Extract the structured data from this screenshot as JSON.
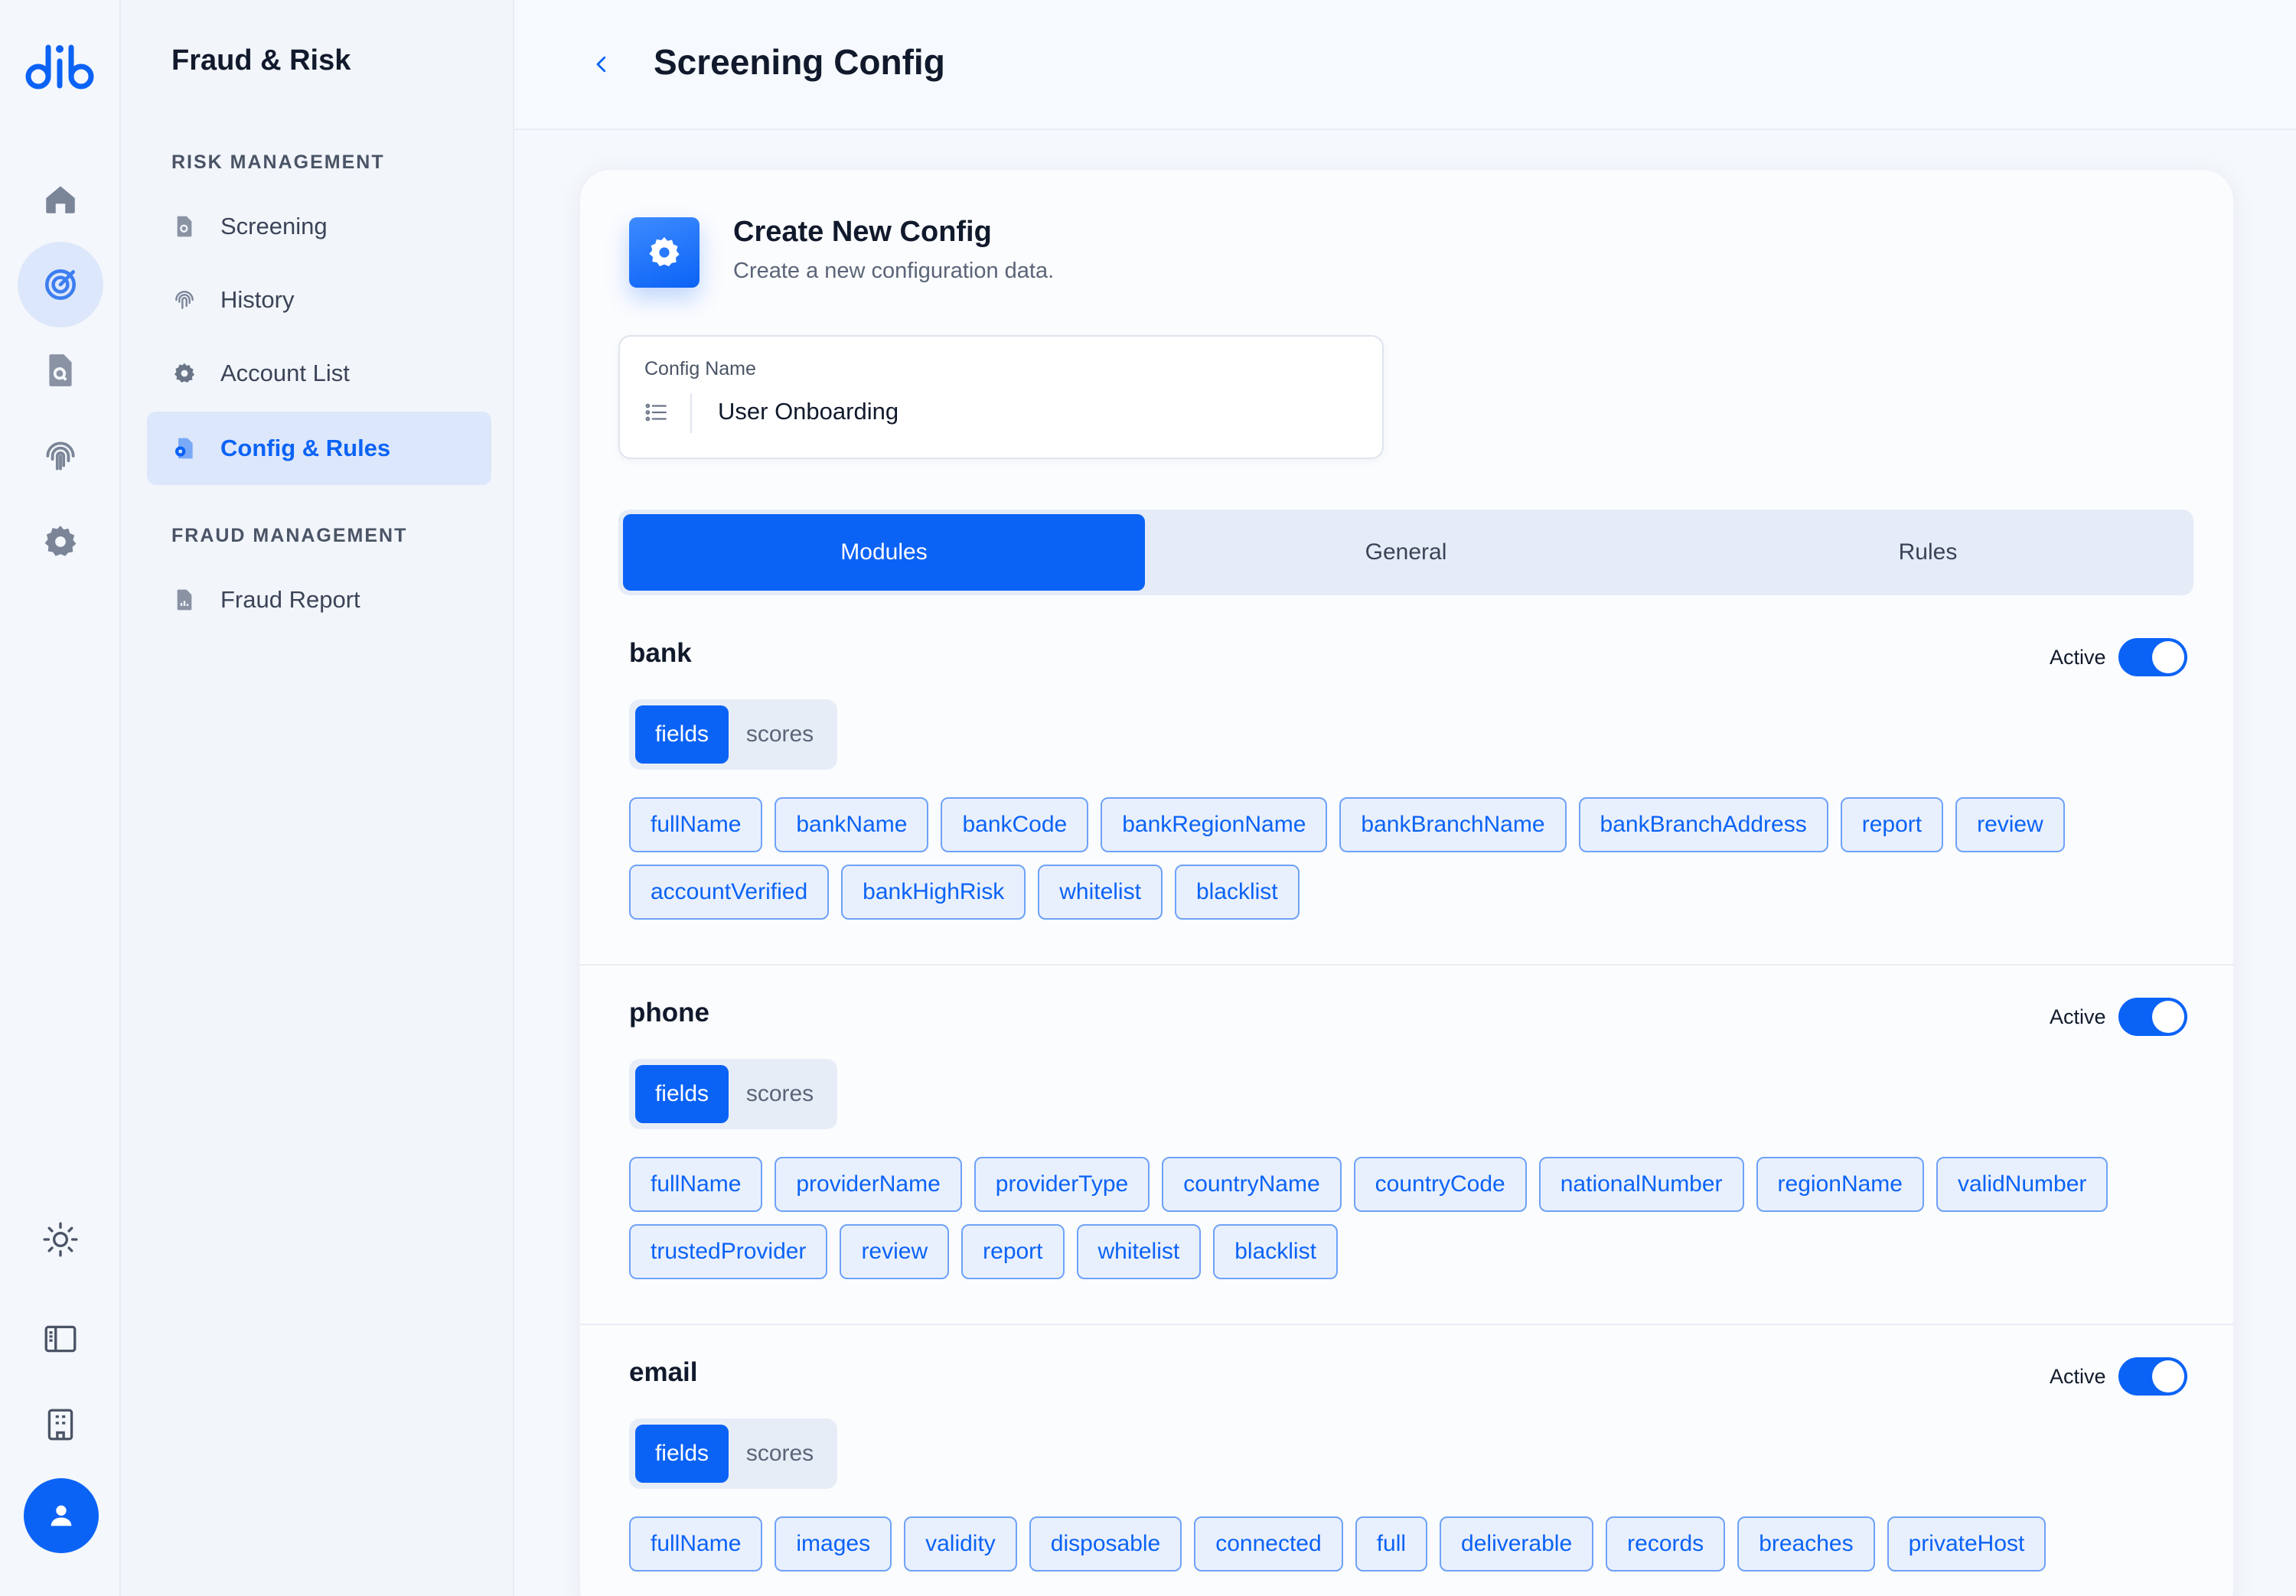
{
  "nav": {
    "app_title": "Fraud & Risk",
    "sections": [
      {
        "title": "RISK MANAGEMENT",
        "items": [
          {
            "label": "Screening",
            "icon": "document-search-icon",
            "active": false
          },
          {
            "label": "History",
            "icon": "fingerprint-icon",
            "active": false
          },
          {
            "label": "Account List",
            "icon": "gear-icon",
            "active": false
          },
          {
            "label": "Config & Rules",
            "icon": "config-document-icon",
            "active": true
          }
        ]
      },
      {
        "title": "FRAUD MANAGEMENT",
        "items": [
          {
            "label": "Fraud Report",
            "icon": "report-chart-icon",
            "active": false
          }
        ]
      }
    ]
  },
  "header": {
    "title": "Screening Config"
  },
  "card": {
    "title": "Create New Config",
    "subtitle": "Create a new configuration data.",
    "config_name_label": "Config Name",
    "config_name_value": "User Onboarding"
  },
  "tabs": [
    "Modules",
    "General",
    "Rules"
  ],
  "active_tab": "Modules",
  "modules": [
    {
      "name": "bank",
      "status_label": "Active",
      "active": true,
      "seg": {
        "on": "fields",
        "off": "scores"
      },
      "rows": [
        [
          "fullName",
          "bankName",
          "bankCode",
          "bankRegionName",
          "bankBranchName",
          "bankBranchAddress",
          "report",
          "review"
        ],
        [
          "accountVerified",
          "bankHighRisk",
          "whitelist",
          "blacklist"
        ]
      ]
    },
    {
      "name": "phone",
      "status_label": "Active",
      "active": true,
      "seg": {
        "on": "fields",
        "off": "scores"
      },
      "rows": [
        [
          "fullName",
          "providerName",
          "providerType",
          "countryName",
          "countryCode",
          "nationalNumber",
          "regionName",
          "validNumber"
        ],
        [
          "trustedProvider",
          "review",
          "report",
          "whitelist",
          "blacklist"
        ]
      ]
    },
    {
      "name": "email",
      "status_label": "Active",
      "active": true,
      "seg": {
        "on": "fields",
        "off": "scores"
      },
      "rows": [
        [
          "fullName",
          "images",
          "validity",
          "disposable",
          "connected",
          "full",
          "deliverable",
          "records",
          "breaches",
          "privateHost"
        ]
      ]
    }
  ],
  "colors": {
    "accent": "#0b63f6",
    "chip_bg": "#e9f0fd",
    "chip_border": "#6ea2f8"
  }
}
